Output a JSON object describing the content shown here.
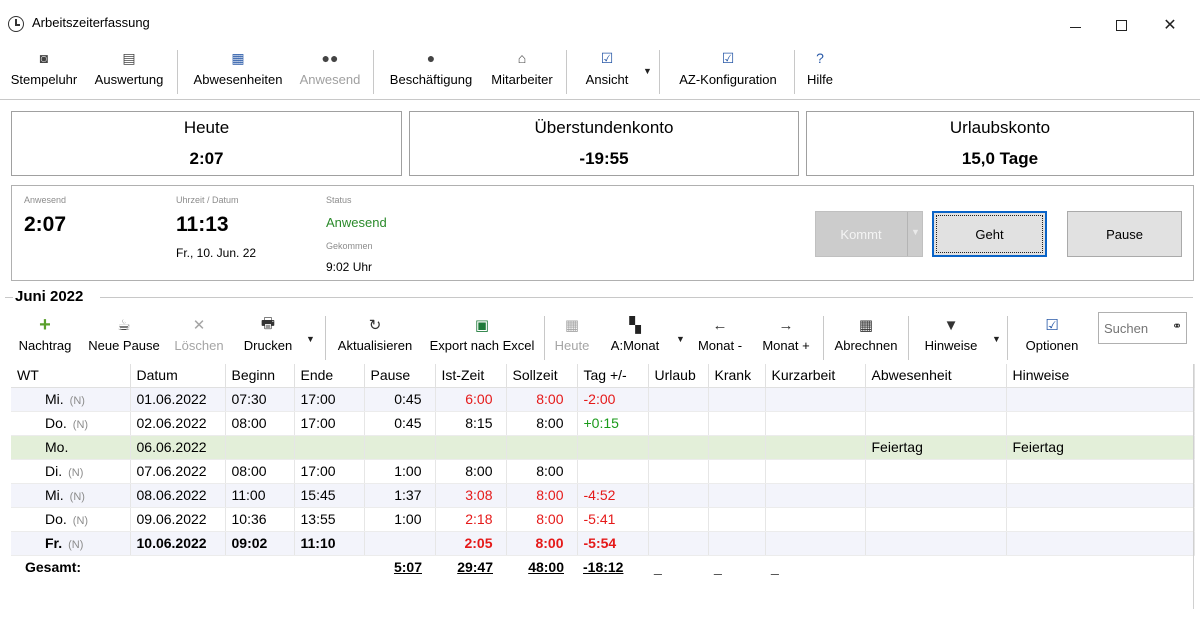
{
  "window": {
    "title": "Arbeitszeiterfassung"
  },
  "toolbar": {
    "items": [
      {
        "label": "Stempeluhr",
        "icon": "clock-icon"
      },
      {
        "label": "Auswertung",
        "icon": "report-icon"
      },
      {
        "label": "Abwesenheiten",
        "icon": "calendar-grid-icon"
      },
      {
        "label": "Anwesend",
        "icon": "people-icon",
        "disabled": true
      },
      {
        "label": "Beschäftigung",
        "icon": "person-icon"
      },
      {
        "label": "Mitarbeiter",
        "icon": "employees-icon"
      },
      {
        "label": "Ansicht",
        "icon": "view-icon"
      },
      {
        "label": "AZ-Konfiguration",
        "icon": "config-icon"
      },
      {
        "label": "Hilfe",
        "icon": "help-icon"
      }
    ]
  },
  "summary": {
    "heute": {
      "label": "Heute",
      "value": "2:07"
    },
    "ueberstunden": {
      "label": "Überstundenkonto",
      "value": "-19:55"
    },
    "urlaub": {
      "label": "Urlaubskonto",
      "value": "15,0 Tage"
    }
  },
  "status": {
    "anwesend_label": "Anwesend",
    "anwesend_value": "2:07",
    "uhrzeit_label": "Uhrzeit / Datum",
    "uhrzeit_value": "11:13",
    "datum_value": "Fr., 10. Jun. 22",
    "status_label": "Status",
    "status_value": "Anwesend",
    "gekommen_label": "Gekommen",
    "gekommen_value": "9:02 Uhr",
    "buttons": {
      "kommt": "Kommt",
      "geht": "Geht",
      "pause": "Pause"
    }
  },
  "month": {
    "title": "Juni 2022",
    "toolbar": [
      {
        "label": "Nachtrag",
        "icon": "plus-icon"
      },
      {
        "label": "Neue Pause",
        "icon": "coffee-icon"
      },
      {
        "label": "Löschen",
        "icon": "delete-icon",
        "disabled": true
      },
      {
        "label": "Drucken",
        "icon": "printer-icon"
      },
      {
        "label": "Aktualisieren",
        "icon": "refresh-icon"
      },
      {
        "label": "Export nach Excel",
        "icon": "excel-icon"
      },
      {
        "label": "Heute",
        "icon": "calendar-icon",
        "disabled": true
      },
      {
        "label": "A:Monat",
        "icon": "tiles-icon"
      },
      {
        "label": "Monat -",
        "icon": "arrow-left-icon"
      },
      {
        "label": "Monat +",
        "icon": "arrow-right-icon"
      },
      {
        "label": "Abrechnen",
        "icon": "calculator-icon"
      },
      {
        "label": "Hinweise",
        "icon": "filter-icon"
      },
      {
        "label": "Optionen",
        "icon": "options-icon"
      }
    ],
    "search_placeholder": "Suchen"
  },
  "table": {
    "columns": [
      "WT",
      "Datum",
      "Beginn",
      "Ende",
      "Pause",
      "Ist-Zeit",
      "Sollzeit",
      "Tag +/-",
      "Urlaub",
      "Krank",
      "Kurzarbeit",
      "Abwesenheit",
      "Hinweise"
    ],
    "rows": [
      {
        "wt": "Mi.",
        "n": "(N)",
        "datum": "01.06.2022",
        "beginn": "07:30",
        "ende": "17:00",
        "pause": "0:45",
        "ist": "6:00",
        "soll": "8:00",
        "tag": "-2:00",
        "abw": "",
        "hinw": ""
      },
      {
        "wt": "Do.",
        "n": "(N)",
        "datum": "02.06.2022",
        "beginn": "08:00",
        "ende": "17:00",
        "pause": "0:45",
        "ist": "8:15",
        "soll": "8:00",
        "tag": "+0:15",
        "abw": "",
        "hinw": ""
      },
      {
        "wt": "Mo.",
        "n": "",
        "datum": "06.06.2022",
        "beginn": "",
        "ende": "",
        "pause": "",
        "ist": "",
        "soll": "",
        "tag": "",
        "abw": "Feiertag",
        "hinw": "Feiertag"
      },
      {
        "wt": "Di.",
        "n": "(N)",
        "datum": "07.06.2022",
        "beginn": "08:00",
        "ende": "17:00",
        "pause": "1:00",
        "ist": "8:00",
        "soll": "8:00",
        "tag": "",
        "abw": "",
        "hinw": ""
      },
      {
        "wt": "Mi.",
        "n": "(N)",
        "datum": "08.06.2022",
        "beginn": "11:00",
        "ende": "15:45",
        "pause": "1:37",
        "ist": "3:08",
        "soll": "8:00",
        "tag": "-4:52",
        "abw": "",
        "hinw": ""
      },
      {
        "wt": "Do.",
        "n": "(N)",
        "datum": "09.06.2022",
        "beginn": "10:36",
        "ende": "13:55",
        "pause": "1:00",
        "ist": "2:18",
        "soll": "8:00",
        "tag": "-5:41",
        "abw": "",
        "hinw": ""
      },
      {
        "wt": "Fr.",
        "n": "(N)",
        "datum": "10.06.2022",
        "beginn": "09:02",
        "ende": "11:10",
        "pause": "",
        "ist": "2:05",
        "soll": "8:00",
        "tag": "-5:54",
        "abw": "",
        "hinw": ""
      }
    ],
    "total": {
      "label": "Gesamt:",
      "pause": "5:07",
      "ist": "29:47",
      "soll": "48:00",
      "tag": "-18:12",
      "urlaub": "_",
      "krank": "_",
      "kurzarbeit": "_"
    }
  },
  "colors": {
    "negative": "#e51919",
    "positive": "#1a9a1a",
    "holiday_row": "#e3efd9",
    "alt_row": "#f3f4fb",
    "status_green": "#2a8a2a",
    "focus_border": "#0a64c8"
  }
}
